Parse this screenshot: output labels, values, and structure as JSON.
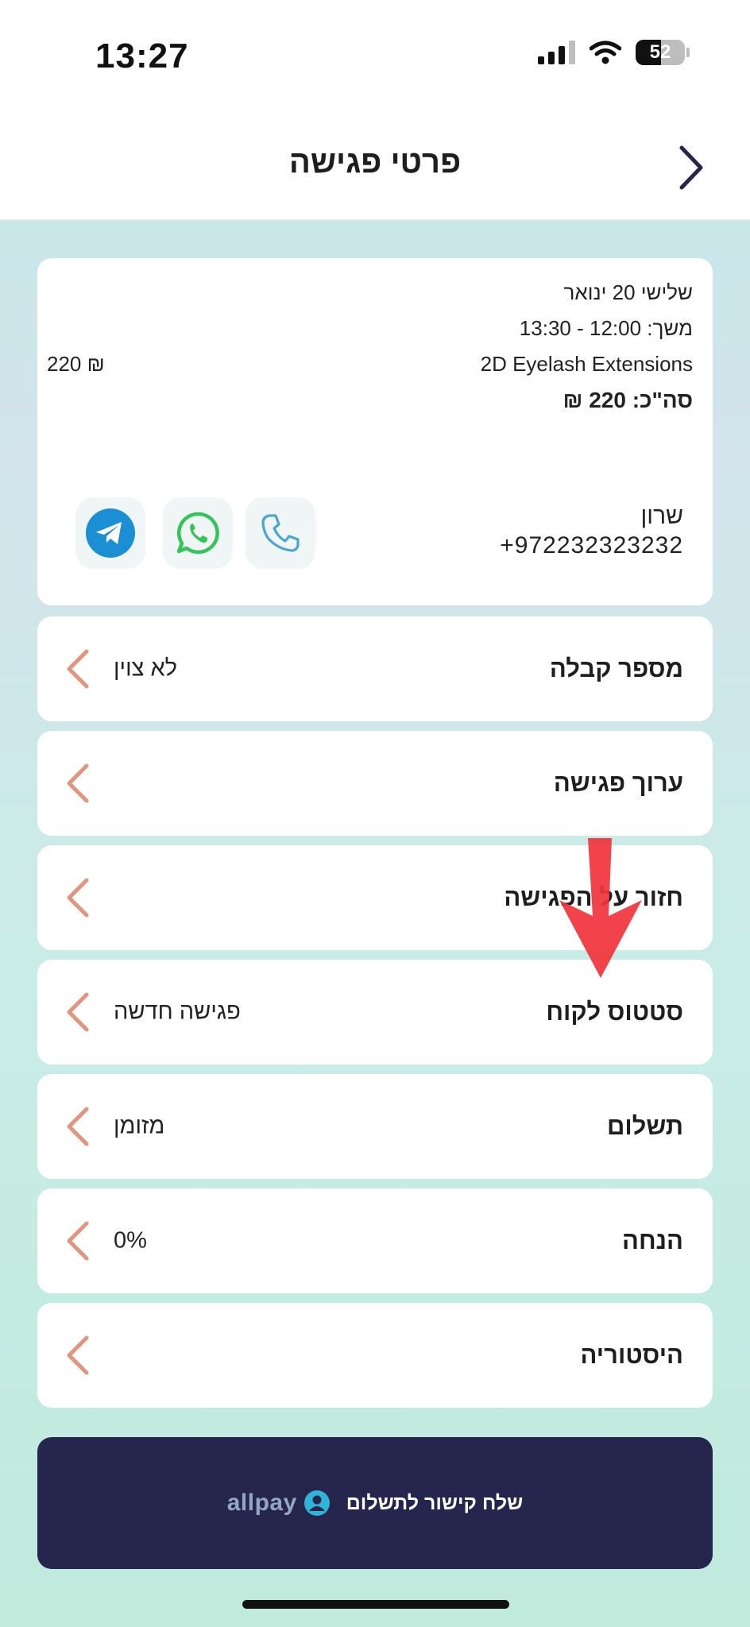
{
  "status_bar": {
    "time": "13:27",
    "battery": "52"
  },
  "header": {
    "title": "פרטי פגישה"
  },
  "appointment": {
    "date": "שלישי 20 ינואר",
    "duration": "משך: 12:00 - 13:30",
    "service": "2D Eyelash Extensions",
    "service_price": "220 ₪",
    "total": "סה\"כ: 220 ₪"
  },
  "contact": {
    "name": "שרון",
    "phone": "+972232323232",
    "actions": [
      "phone-icon",
      "whatsapp-icon",
      "telegram-icon"
    ]
  },
  "rows": [
    {
      "label": "מספר קבלה",
      "value": "לא צוין"
    },
    {
      "label": "ערוך פגישה",
      "value": ""
    },
    {
      "label": "חזור על הפגישה",
      "value": ""
    },
    {
      "label": "סטטוס לקוח",
      "value": "פגישה חדשה"
    },
    {
      "label": "תשלום",
      "value": "מזומן"
    },
    {
      "label": "הנחה",
      "value": "0%"
    },
    {
      "label": "היסטוריה",
      "value": ""
    }
  ],
  "payment_button": {
    "label": "שלח קישור לתשלום",
    "brand": "allpay"
  },
  "colors": {
    "chevron": "#e2957d",
    "pay_button_bg": "#26254d",
    "annotation_arrow": "#f0333a"
  }
}
